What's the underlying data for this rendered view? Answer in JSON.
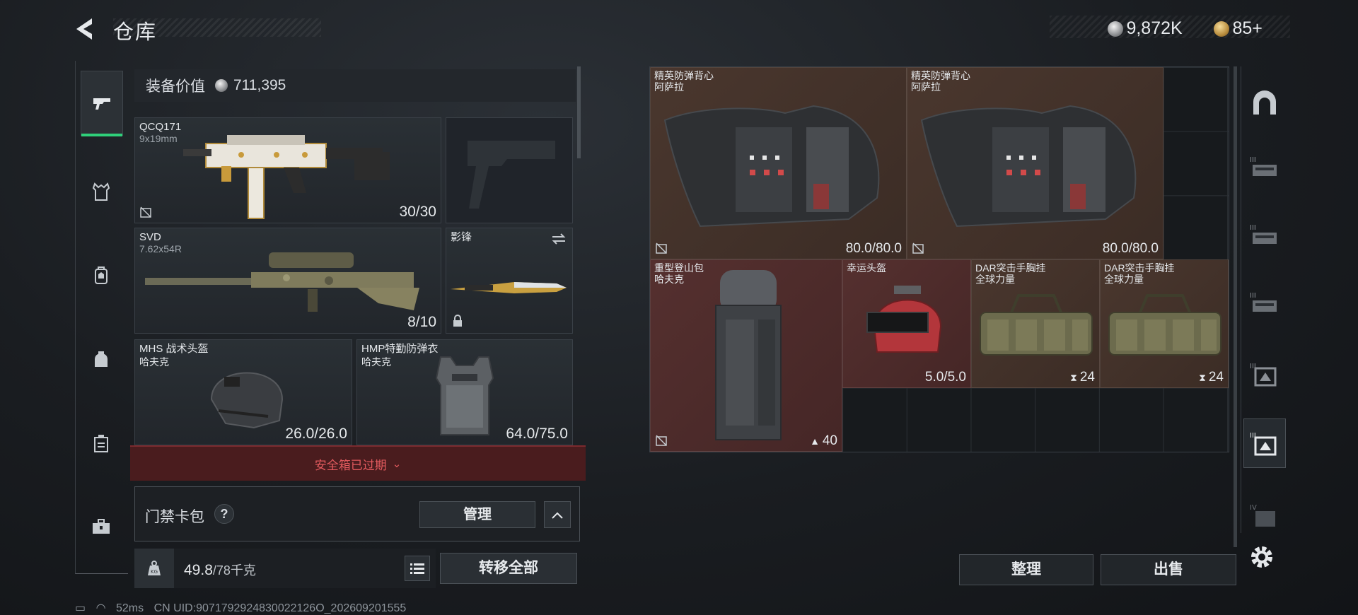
{
  "header": {
    "title": "仓库",
    "currency_silver": "9,872K",
    "currency_gold": "85+"
  },
  "left_rail": {
    "items": [
      "weapons",
      "vest",
      "backpack",
      "bag",
      "case",
      "toolbox"
    ]
  },
  "equipment": {
    "value_label": "装备价值",
    "value": "711,395",
    "primary": {
      "name": "QCQ171",
      "ammo": "9x19mm",
      "count": "30/30"
    },
    "pistol": {
      "name": ""
    },
    "secondary": {
      "name": "SVD",
      "ammo": "7.62x54R",
      "count": "8/10"
    },
    "melee": {
      "name": "影锋"
    },
    "helmet": {
      "name": "MHS 战术头盔",
      "brand": "哈夫克",
      "durability": "26.0/26.0"
    },
    "armor": {
      "name": "HMP特勤防弹衣",
      "brand": "哈夫克",
      "durability": "64.0/75.0"
    }
  },
  "safe_box": {
    "label": "安全箱已过期"
  },
  "card_pack": {
    "label": "门禁卡包",
    "help": "?",
    "manage": "管理"
  },
  "weight": {
    "current": "49.8",
    "max": "/78千克",
    "transfer_all": "转移全部"
  },
  "status": {
    "ping": "52ms",
    "uid": "CN UID:9071792924830022126O_202609201555"
  },
  "stash_items": [
    {
      "name": "精英防弹背心",
      "brand": "阿萨拉",
      "value": "80.0/80.0"
    },
    {
      "name": "精英防弹背心",
      "brand": "阿萨拉",
      "value": "80.0/80.0"
    },
    {
      "name": "重型登山包",
      "brand": "哈夫克",
      "value": "40"
    },
    {
      "name": "幸运头盔",
      "brand": "",
      "value": "5.0/5.0"
    },
    {
      "name": "DAR突击手胸挂",
      "brand": "全球力量",
      "value": "24"
    },
    {
      "name": "DAR突击手胸挂",
      "brand": "全球力量",
      "value": "24"
    }
  ],
  "buttons": {
    "sort": "整理",
    "sell": "出售"
  },
  "colors": {
    "accent_green": "#2fd07a",
    "alert_red": "#e25a5e",
    "brown_cell": "#4a372e",
    "red_cell": "#55302f"
  }
}
